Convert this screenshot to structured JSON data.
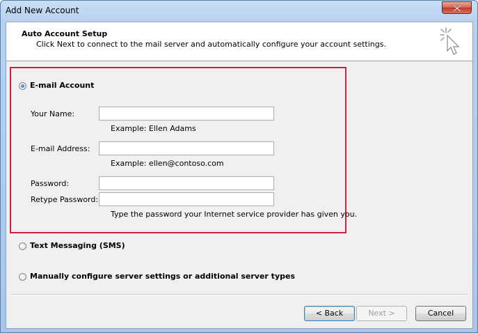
{
  "window": {
    "title": "Add New Account"
  },
  "header": {
    "title": "Auto Account Setup",
    "subtitle": "Click Next to connect to the mail server and automatically configure your account settings."
  },
  "options": {
    "email_account": {
      "label": "E-mail Account",
      "checked": true
    },
    "text_messaging": {
      "label": "Text Messaging (SMS)",
      "checked": false
    },
    "manual": {
      "label": "Manually configure server settings or additional server types",
      "checked": false
    }
  },
  "form": {
    "your_name": {
      "label": "Your Name:",
      "value": "",
      "hint": "Example: Ellen Adams"
    },
    "email": {
      "label": "E-mail Address:",
      "value": "",
      "hint": "Example: ellen@contoso.com"
    },
    "password": {
      "label": "Password:",
      "value": ""
    },
    "retype_password": {
      "label": "Retype Password:",
      "value": "",
      "hint": "Type the password your Internet service provider has given you."
    }
  },
  "buttons": {
    "back": "< Back",
    "next": "Next >",
    "cancel": "Cancel"
  },
  "colors": {
    "highlight_border": "#d21f3c"
  }
}
